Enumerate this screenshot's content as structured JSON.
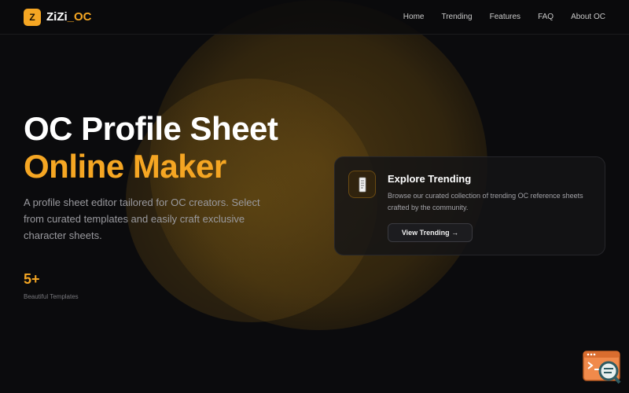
{
  "header": {
    "logo_badge": "Z",
    "logo_name": "ZiZi",
    "logo_suffix": "_OC",
    "nav": [
      "Home",
      "Trending",
      "Features",
      "FAQ",
      "About OC"
    ]
  },
  "hero": {
    "title_line1": "OC Profile Sheet",
    "title_line2": "Online Maker",
    "description": "A profile sheet editor tailored for OC creators. Select from curated templates and easily craft exclusive character sheets.",
    "stat_value": "5+",
    "stat_label": "Beautiful Templates"
  },
  "card": {
    "title": "Explore Trending",
    "description": "Browse our curated collection of trending OC reference sheets crafted by the community.",
    "button_label": "View Trending →",
    "icon": "document-icon"
  },
  "colors": {
    "accent": "#f5a623",
    "background": "#0b0b0d"
  },
  "widget": {
    "icon": "terminal-search-icon"
  }
}
